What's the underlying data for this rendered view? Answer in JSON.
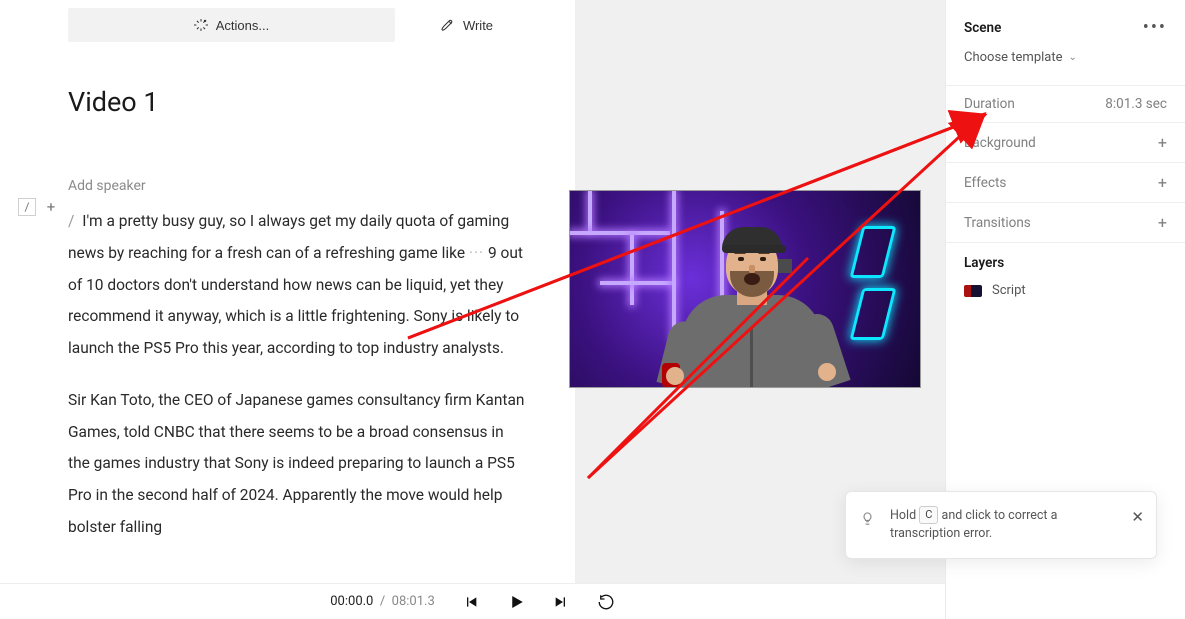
{
  "toolbar": {
    "actions_label": "Actions...",
    "write_label": "Write"
  },
  "title": "Video 1",
  "add_speaker": "Add speaker",
  "rail": {
    "slash": "/",
    "plus": "+"
  },
  "transcript": {
    "slash": "/",
    "p1_a": "I'm a pretty busy guy, so I always get my daily quota of gaming news by reaching for a fresh can of a refreshing game like",
    "dots": "···",
    "p1_b": "9 out of 10 doctors don't understand how news can be liquid, yet they recommend it anyway, which is a little frightening. Sony is likely to launch the PS5 Pro this year, according to top industry analysts.",
    "p2": "Sir Kan Toto, the CEO of Japanese games consultancy firm Kantan Games, told CNBC that there seems to be a broad consensus in the games industry that Sony is indeed preparing to launch a PS5 Pro in the second half of 2024. Apparently the move would help bolster falling"
  },
  "playback": {
    "current": "00:00.0",
    "sep": "/",
    "total": "08:01.3"
  },
  "props": {
    "scene_label": "Scene",
    "choose_template": "Choose template",
    "duration_label": "Duration",
    "duration_value": "8:01.3 sec",
    "background_label": "Background",
    "effects_label": "Effects",
    "transitions_label": "Transitions",
    "layers_label": "Layers",
    "layer_script": "Script"
  },
  "tip": {
    "pre": "Hold",
    "key": "C",
    "post": "and click to correct a transcription error."
  }
}
